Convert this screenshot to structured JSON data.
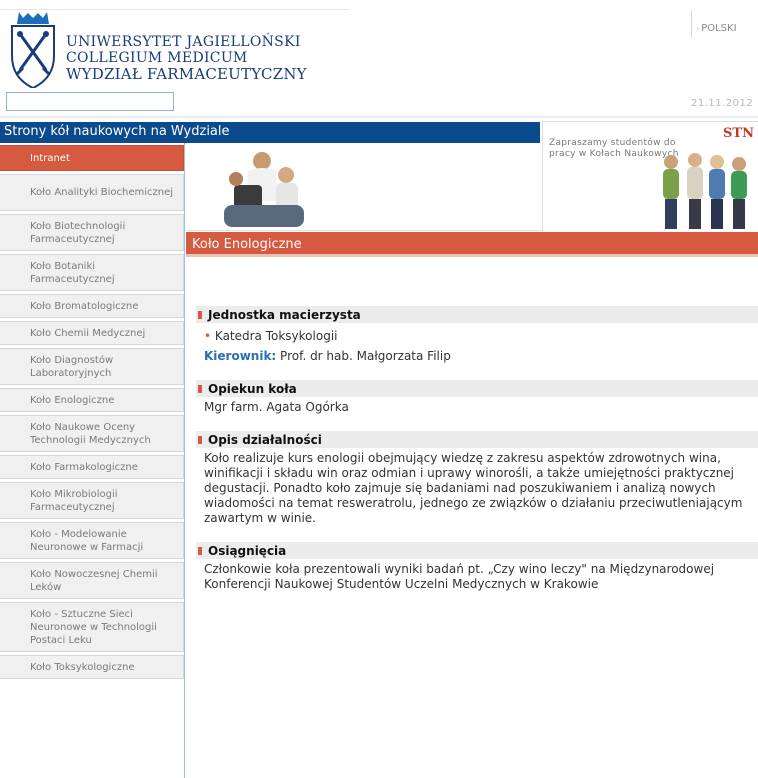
{
  "header": {
    "uni_line1": "UNIWERSYTET JAGIELLOŃSKI",
    "uni_line2": "COLLEGIUM MEDICUM",
    "uni_line3": "WYDZIAŁ FARMACEUTYCZNY",
    "lang": "POLSKI",
    "date": "21.11.2012",
    "search": {
      "value": "",
      "placeholder": ""
    }
  },
  "bluebar": {
    "title": "Strony kół naukowych na Wydziale"
  },
  "stn": {
    "label": "STN",
    "text": "Zapraszamy studentów do pracy w Kołach Naukowych"
  },
  "sidebar": {
    "items": [
      {
        "label": "Intranet",
        "active": true
      },
      {
        "label": "Koło Analityki Biochemicznej"
      },
      {
        "label": "Koło Biotechnologii Farmaceutycznej"
      },
      {
        "label": "Koło Botaniki Farmaceutycznej"
      },
      {
        "label": "Koło Bromatologiczne"
      },
      {
        "label": "Koło Chemii Medycznej"
      },
      {
        "label": "Koło Diagnostów Laboratoryjnych"
      },
      {
        "label": "Koło Enologiczne"
      },
      {
        "label": "Koło Naukowe Oceny Technologii Medycznych"
      },
      {
        "label": "Koło Farmakologiczne"
      },
      {
        "label": "Koło Mikrobiologii Farmaceutycznej"
      },
      {
        "label": "Koło - Modelowanie Neuronowe w Farmacji"
      },
      {
        "label": "Koło Nowoczesnej Chemii Leków"
      },
      {
        "label": "Koło - Sztuczne Sieci Neuronowe w Technologii Postaci Leku"
      },
      {
        "label": "Koło Toksykologiczne"
      }
    ]
  },
  "section": {
    "title": "Koło Enologiczne"
  },
  "content": {
    "unit_title": "Jednostka macierzysta",
    "unit_value": "Katedra Toksykologii",
    "head_label": "Kierownik:",
    "head_value": " Prof. dr hab. Małgorzata Filip",
    "advisor_title": "Opiekun koła",
    "advisor_value": "Mgr farm. Agata Ogórka",
    "desc_title": "Opis działalności",
    "desc_value": "Koło realizuje kurs enologii obejmujący wiedzę z zakresu aspektów zdrowotnych wina, winifikacji i składu win oraz odmian i uprawy winorośli, a także umiejętności praktycznej degustacji. Ponadto koło zajmuje się badaniami nad poszukiwaniem i analizą nowych wiadomości na temat resweratrolu, jednego ze związków o działaniu przeciwutleniającym zawartym w winie.",
    "ach_title": "Osiągnięcia",
    "ach_value": "Członkowie koła prezentowali wyniki badań pt. „Czy wino leczy\" na Międzynarodowej Konferencji Naukowej Studentów Uczelni Medycznych w Krakowie"
  },
  "colors": {
    "brand_blue": "#0b4a8c",
    "accent_red": "#d65a3f",
    "link_blue": "#2a6fb0"
  }
}
